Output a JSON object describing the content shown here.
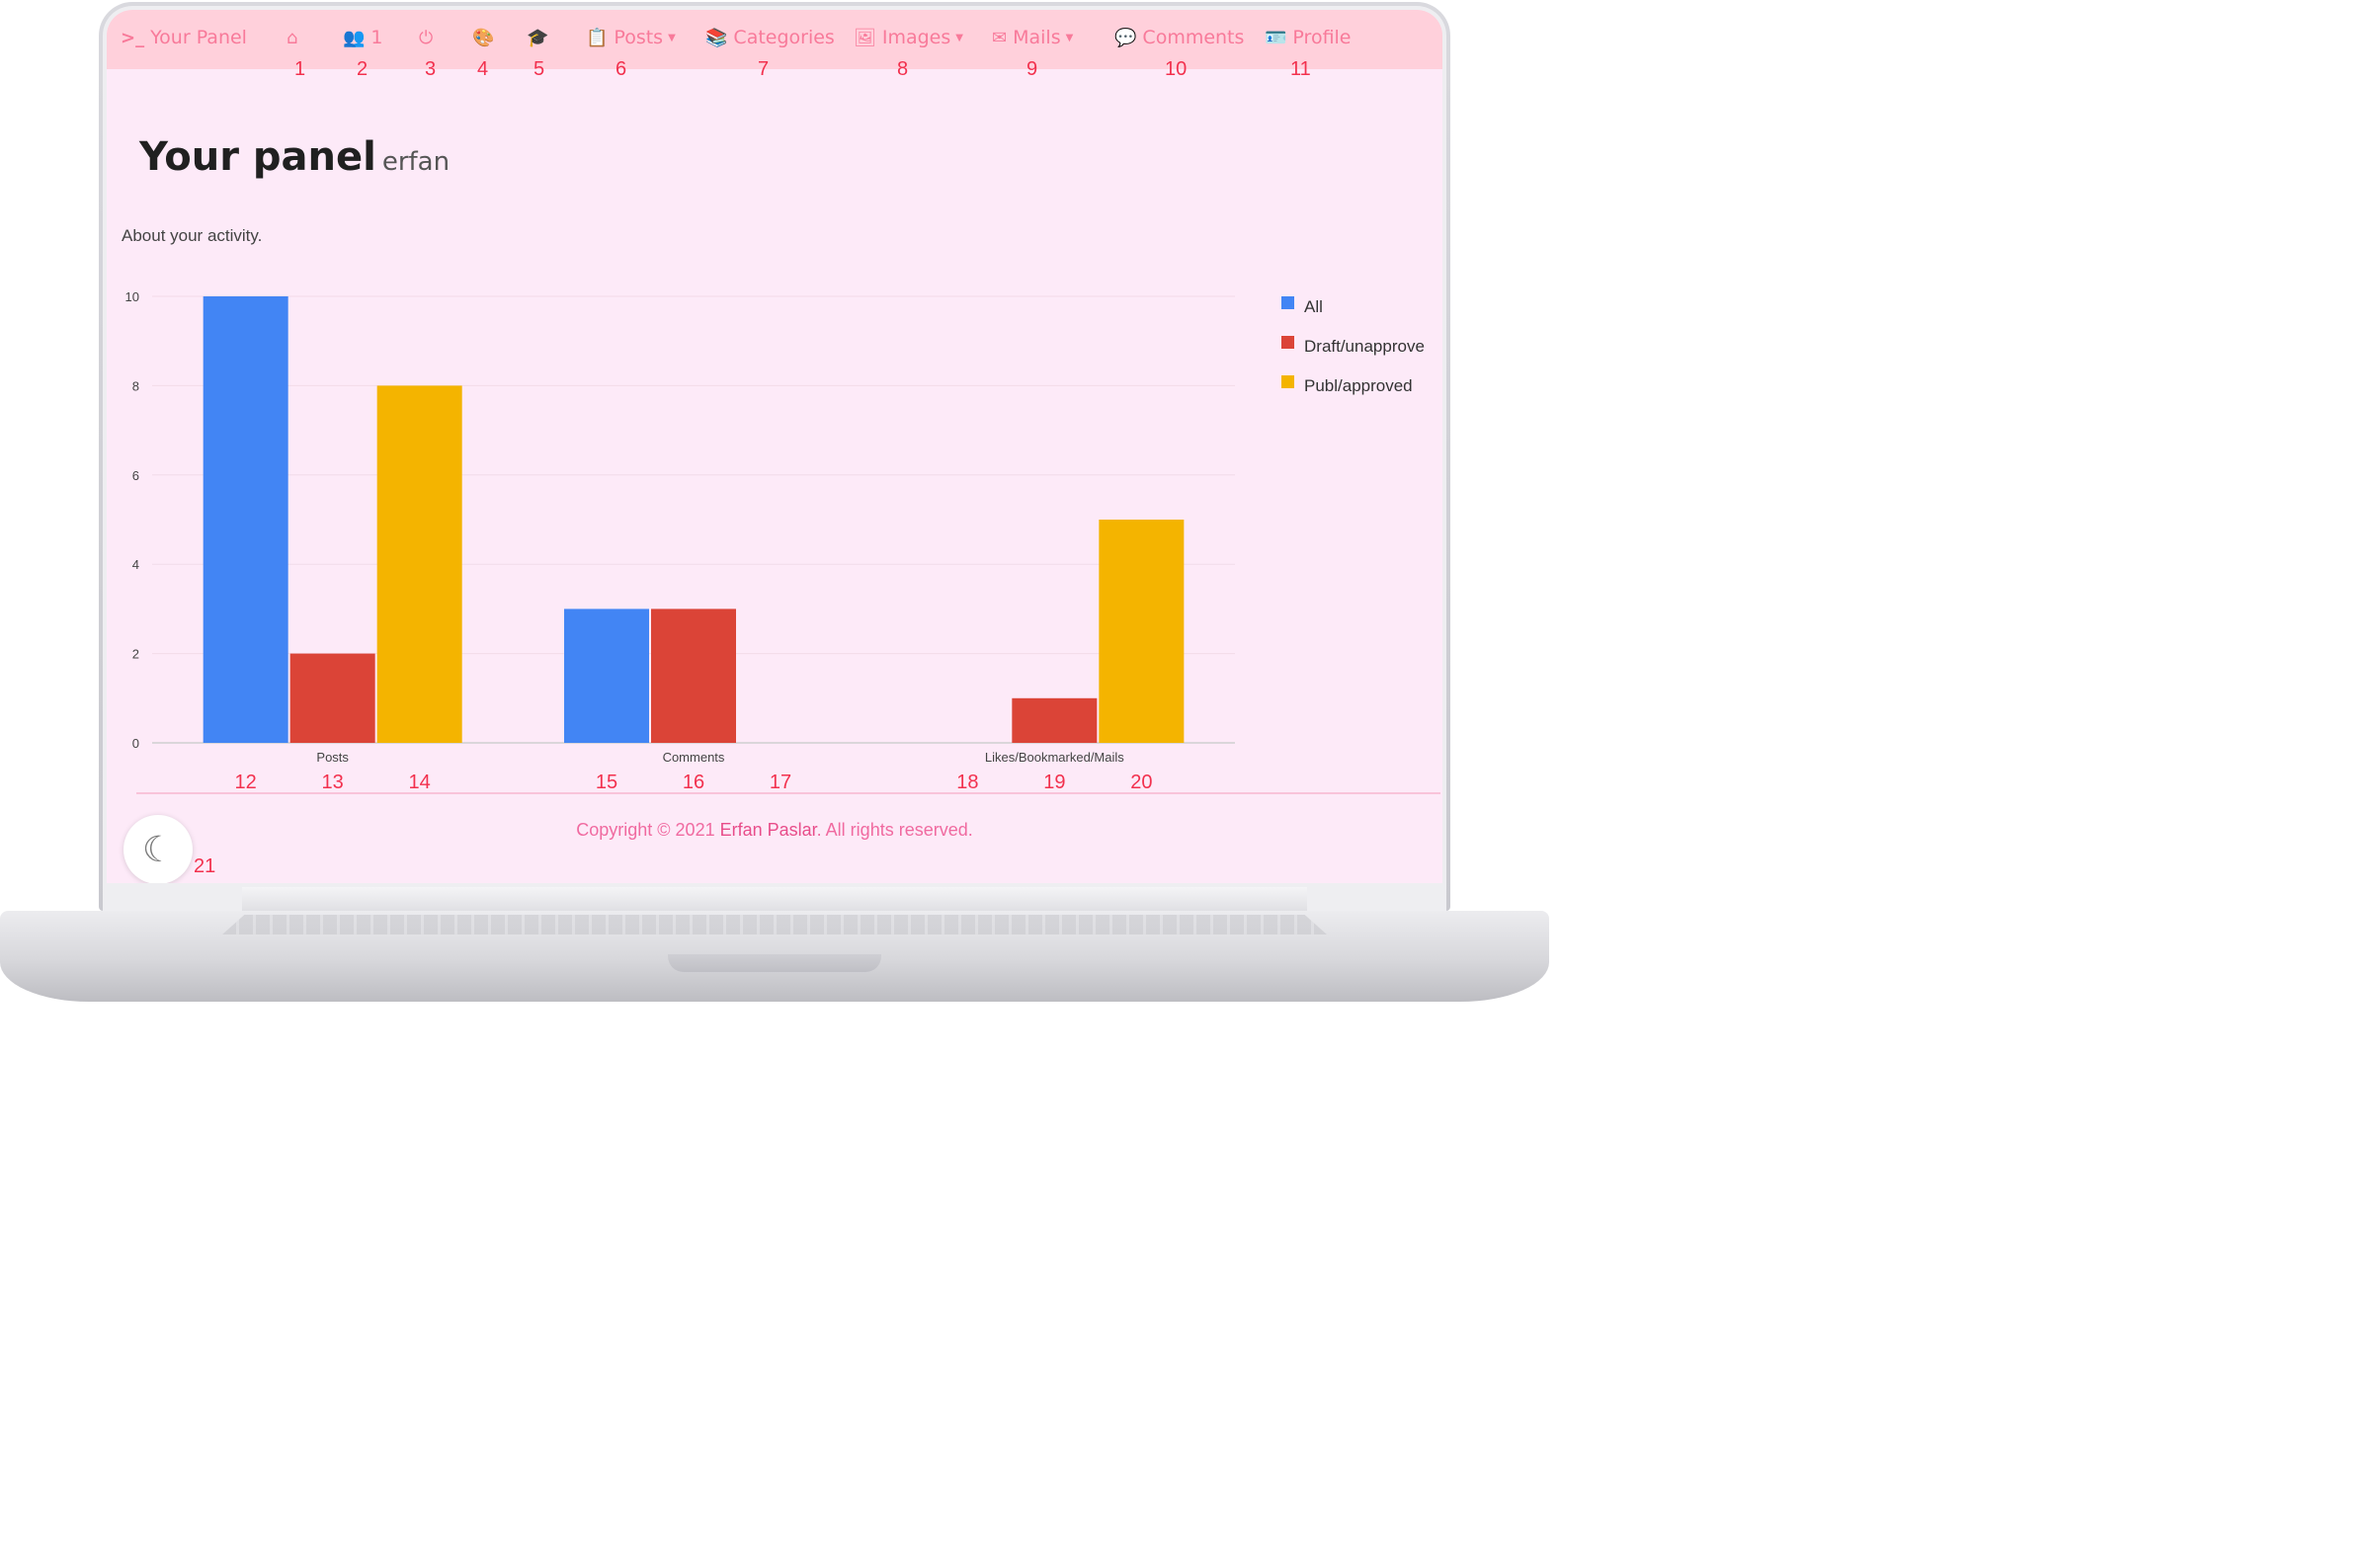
{
  "nav": {
    "brand": {
      "icon": "terminal-icon",
      "label": "Your Panel"
    },
    "items": [
      {
        "name": "home",
        "icon": "home-icon",
        "label": "",
        "num": "1"
      },
      {
        "name": "users",
        "icon": "users-icon",
        "label": "1",
        "num": "2"
      },
      {
        "name": "logout",
        "icon": "power-icon",
        "label": "",
        "num": "3"
      },
      {
        "name": "theme",
        "icon": "palette-icon",
        "label": "",
        "num": "4"
      },
      {
        "name": "learn",
        "icon": "graduation-cap-icon",
        "label": "",
        "num": "5"
      },
      {
        "name": "posts",
        "icon": "clipboard-icon",
        "label": "Posts",
        "num": "6",
        "dropdown": true
      },
      {
        "name": "categories",
        "icon": "books-icon",
        "label": "Categories",
        "num": "7"
      },
      {
        "name": "images",
        "icon": "image-icon",
        "label": "Images",
        "num": "8",
        "dropdown": true
      },
      {
        "name": "mails",
        "icon": "envelope-icon",
        "label": "Mails",
        "num": "9",
        "dropdown": true
      },
      {
        "name": "comments",
        "icon": "comment-icon",
        "label": "Comments",
        "num": "10"
      },
      {
        "name": "profile",
        "icon": "id-card-icon",
        "label": "Profile",
        "num": "11"
      }
    ]
  },
  "page": {
    "title": "Your panel",
    "username": "erfan",
    "about": "About your activity."
  },
  "chart_data": {
    "type": "bar",
    "categories": [
      "Posts",
      "Comments",
      "Likes/Bookmarked/Mails"
    ],
    "series": [
      {
        "name": "All",
        "color": "#4285f4",
        "values": [
          10,
          3,
          0
        ]
      },
      {
        "name": "Draft/unapprove",
        "color": "#db4437",
        "values": [
          2,
          3,
          1
        ]
      },
      {
        "name": "Publ/approved",
        "color": "#f4b400",
        "values": [
          8,
          0,
          5
        ]
      }
    ],
    "yticks": [
      "0",
      "2",
      "4",
      "6",
      "8",
      "10"
    ],
    "ylim": [
      0,
      10
    ],
    "grid": true,
    "legend": "right",
    "bar_numbers": [
      "12",
      "13",
      "14",
      "15",
      "16",
      "17",
      "18",
      "19",
      "20"
    ]
  },
  "footer": {
    "prefix": "Copyright © 2021 ",
    "author": "Erfan Paslar",
    "suffix": ". All rights reserved."
  },
  "theme_toggle": {
    "icon": "moon-icon",
    "num": "21"
  }
}
